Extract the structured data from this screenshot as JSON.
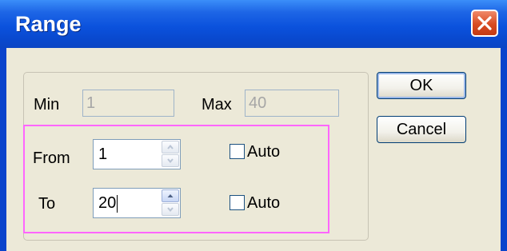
{
  "window": {
    "title": "Range"
  },
  "range": {
    "min_label": "Min",
    "min_value": "1",
    "max_label": "Max",
    "max_value": "40",
    "from_label": "From",
    "from_value": "1",
    "from_auto_label": "Auto",
    "from_auto_checked": false,
    "to_label": "To",
    "to_value": "20",
    "to_auto_label": "Auto",
    "to_auto_checked": false
  },
  "buttons": {
    "ok_label": "OK",
    "cancel_label": "Cancel"
  },
  "icons": {
    "close": "close-icon",
    "spin_up": "chevron-up-icon",
    "spin_down": "chevron-down-icon"
  },
  "colors": {
    "highlight": "#ff66ff",
    "titlebar": "#0b52dd",
    "close_button": "#d84b22"
  }
}
